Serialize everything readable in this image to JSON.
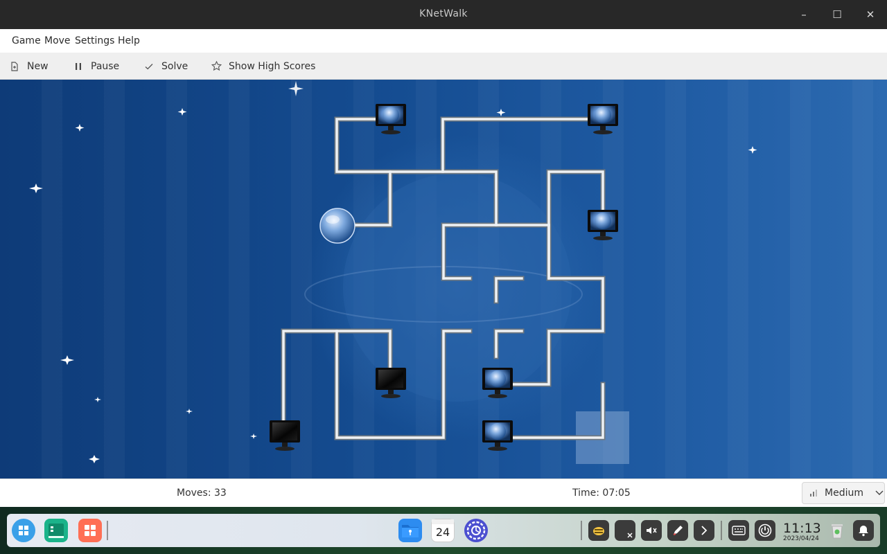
{
  "window": {
    "title": "KNetWalk"
  },
  "menus": [
    "Game",
    "Move",
    "Settings",
    "Help"
  ],
  "toolbar": {
    "new_label": "New",
    "pause_label": "Pause",
    "solve_label": "Solve",
    "highscores_label": "Show High Scores"
  },
  "status": {
    "moves": "Moves: 33",
    "time": "Time: 07:05",
    "difficulty": "Medium"
  },
  "board": {
    "server_icon": "globe-server-icon",
    "client_icon": "monitor-icon",
    "pipe_color": "#d9dce0",
    "background_color": "#154d92"
  },
  "taskbar": {
    "clock_time": "11:13",
    "clock_date": "2023/04/24",
    "calendar_day": "24",
    "apps": [
      "launcher-icon",
      "file-manager-icon",
      "app-store-icon",
      "file-manager-blue-icon",
      "calendar-icon",
      "settings-icon"
    ],
    "tray": [
      "pet-icon",
      "close-icon",
      "mute-icon",
      "pen-icon",
      "chevron-right-icon",
      "keyboard-icon",
      "power-icon",
      "trash-icon",
      "bell-icon"
    ]
  }
}
